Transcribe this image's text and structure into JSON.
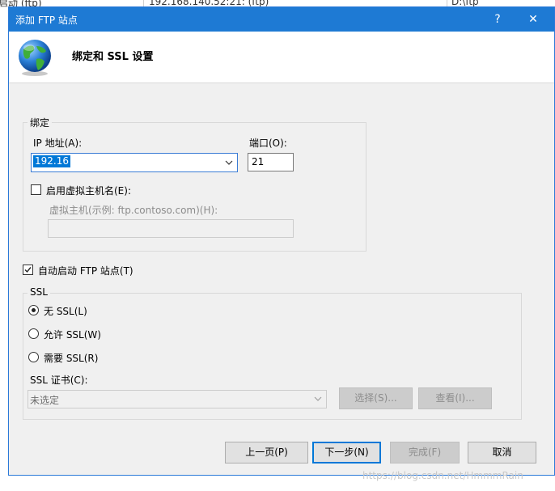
{
  "background": {
    "row_texts": [
      "启动 (ftp)",
      "192.168.140.52:21: (ftp)",
      "D:\\ftp"
    ]
  },
  "window": {
    "title": "添加 FTP 站点",
    "help_glyph": "?",
    "close_glyph": "✕"
  },
  "header": {
    "title": "绑定和 SSL 设置",
    "icon": "globe-icon"
  },
  "binding": {
    "legend": "绑定",
    "ip_label": "IP 地址(A):",
    "ip_value": "192.16",
    "port_label": "端口(O):",
    "port_value": "21",
    "vhost_checkbox_label": "启用虚拟主机名(E):",
    "vhost_checked": false,
    "vhost_example_label": "虚拟主机(示例: ftp.contoso.com)(H):",
    "vhost_value": ""
  },
  "autostart": {
    "label": "自动启动 FTP 站点(T)",
    "checked": true
  },
  "ssl": {
    "legend": "SSL",
    "options": [
      {
        "label": "无 SSL(L)",
        "selected": true
      },
      {
        "label": "允许 SSL(W)",
        "selected": false
      },
      {
        "label": "需要 SSL(R)",
        "selected": false
      }
    ],
    "cert_label": "SSL 证书(C):",
    "cert_value": "未选定",
    "select_button": "选择(S)...",
    "view_button": "查看(I)..."
  },
  "footer": {
    "prev": "上一页(P)",
    "next": "下一步(N)",
    "finish": "完成(F)",
    "cancel": "取消"
  },
  "watermark": "https://blog.csdn.net/HmmmRain",
  "colors": {
    "titlebar": "#1e7ad4",
    "accent": "#0078d7",
    "dialog_bg": "#f0f0f0"
  }
}
